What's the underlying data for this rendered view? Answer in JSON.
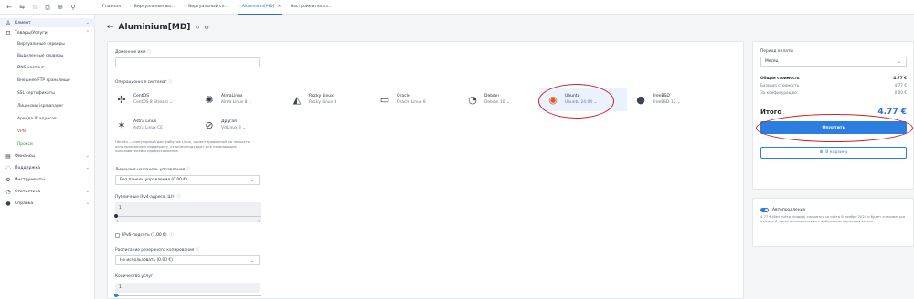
{
  "topbar": {
    "icons": [
      "back-arrow-icon",
      "split-view-icon",
      "star-icon",
      "library-icon",
      "extensions-icon",
      "search-icon"
    ],
    "tabs": [
      {
        "label": "Главная"
      },
      {
        "label": "Виртуальные вы..."
      },
      {
        "label": "Виртуальный се..."
      },
      {
        "label": "Aluminium[MD]",
        "active": true
      },
      {
        "label": "Настройки польз..."
      }
    ]
  },
  "sidebar": {
    "client": "Клиент",
    "goods": "Товары/Услуги",
    "sub": [
      "Виртуальные серверы",
      "Выделенные серверы",
      "DNS-хостинг",
      "Внешнее FTP хранилище",
      "SSL сертификаты",
      "Лицензии ispmanager",
      "Аренда IP адресов",
      "VPN",
      "Прокси"
    ],
    "finance": "Финансы",
    "support": "Поддержка",
    "tools": "Инструменты",
    "stats": "Статистика",
    "help": "Справка"
  },
  "page": {
    "title": "Aluminium[MD]"
  },
  "form": {
    "domain_label": "Доменное имя",
    "os_label": "Операционная система",
    "os": [
      {
        "name": "CentOS",
        "version": "CentOS 8 Stream",
        "dropdown": true,
        "icon": "centos-icon"
      },
      {
        "name": "AlmaLinux",
        "version": "Alma Linux 8",
        "dropdown": true,
        "icon": "almalinux-icon"
      },
      {
        "name": "Rocky Linux",
        "version": "Rocky Linux 8",
        "dropdown": false,
        "icon": "rocky-linux-icon"
      },
      {
        "name": "Oracle",
        "version": "Oracle Linux 8",
        "dropdown": false,
        "icon": "oracle-icon"
      },
      {
        "name": "Debian",
        "version": "Debian 10",
        "dropdown": true,
        "icon": "debian-icon"
      },
      {
        "name": "Ubuntu",
        "version": "Ubuntu 24.04",
        "dropdown": true,
        "icon": "ubuntu-icon",
        "selected": true
      },
      {
        "name": "FreeBSD",
        "version": "FreeBSD 12",
        "dropdown": true,
        "icon": "freebsd-icon"
      },
      {
        "name": "Astra Linux",
        "version": "Astra Linux CE",
        "dropdown": false,
        "icon": "astra-linux-icon"
      },
      {
        "name": "Другая",
        "version": "VdLinux 8",
        "dropdown": true,
        "icon": "other-os-icon"
      }
    ],
    "os_description": "Ubuntu — популярный дистрибутив Linux, ориентированный на легкость использования и поддержку, отлично подходит для начинающих пользователей и профессионалов.",
    "license_label": "Лицензия на панель управления",
    "license_value": "Без панели управления (0.00 €)",
    "ipv4_label": "Публичные IPv4-адреса, Шт.",
    "ipv4_value": "1",
    "ipv4_min": "1",
    "ipv4_max": "1",
    "ipv6_label": "IPv6-подсеть (1.00 €)",
    "backup_label": "Расписание резервного копирования",
    "backup_value": "Не использовать (0.00 €)",
    "qty_label": "Количество услуг",
    "qty_value": "1"
  },
  "summary": {
    "period_label": "Период оплаты",
    "period_value": "Месяц",
    "total_cost_label": "Общая стоимость",
    "total_cost": "4.77 €",
    "base_cost_label": "Базовая стоимость",
    "base_cost": "4.77 €",
    "config_label": "За конфигурацию",
    "config_cost": "0.00 €",
    "total_label": "Итого",
    "total": "4.77 €",
    "pay_label": "Оплатить",
    "cart_label": "В корзину"
  },
  "autorenew": {
    "label": "Автопродление",
    "enabled": true,
    "text": "4.77 € (без учёта скидки) спишется со счёта 8 ноября 2024 и будет списываться каждое 8 число в соответствии с выбранным периодом заказа"
  },
  "colors": {
    "accent": "#2b7de0",
    "annotation": "#d01f2a"
  }
}
